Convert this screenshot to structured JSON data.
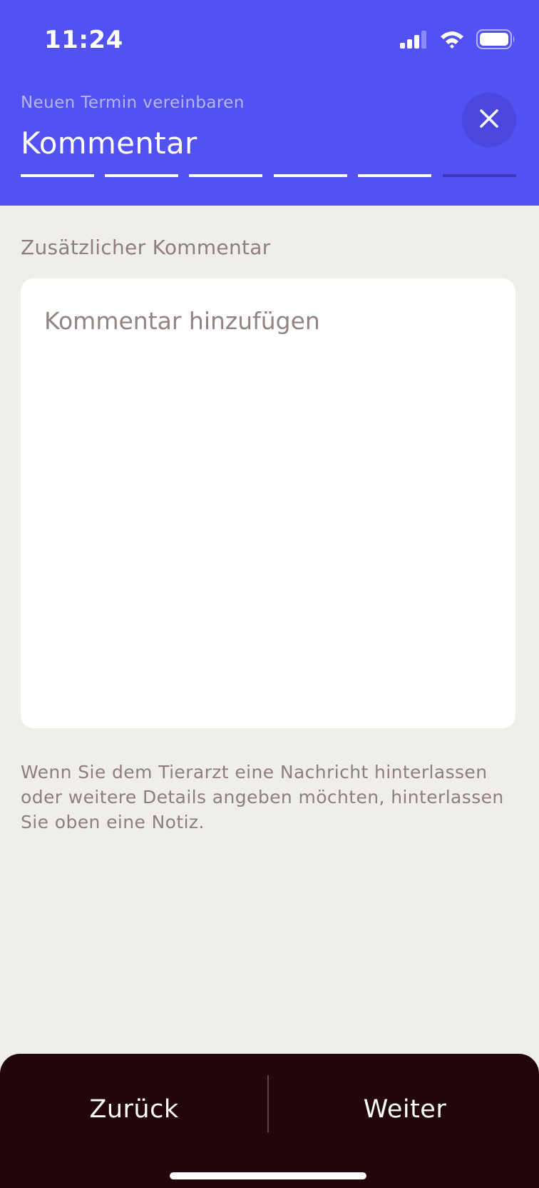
{
  "status_bar": {
    "time": "11:24",
    "icons": [
      "signal-icon",
      "wifi-icon",
      "battery-icon"
    ]
  },
  "header": {
    "subtitle": "Neuen Termin vereinbaren",
    "title": "Kommentar",
    "close_icon": "close-icon",
    "progress": {
      "total_steps": 6,
      "completed_steps": 5
    }
  },
  "form": {
    "section_label": "Zusätzlicher Kommentar",
    "comment_placeholder": "Kommentar hinzufügen",
    "comment_value": "",
    "help_text": "Wenn Sie dem Tierarzt eine Nachricht hinterlassen oder weitere Details angeben möchten, hinterlassen Sie oben eine Notiz."
  },
  "bottom_bar": {
    "back_label": "Zurück",
    "next_label": "Weiter"
  },
  "colors": {
    "header_bg": "#5252F2",
    "page_bg": "#F0EEE9",
    "bottom_bar_bg": "#22060A",
    "muted_text": "#8E7E7E"
  }
}
